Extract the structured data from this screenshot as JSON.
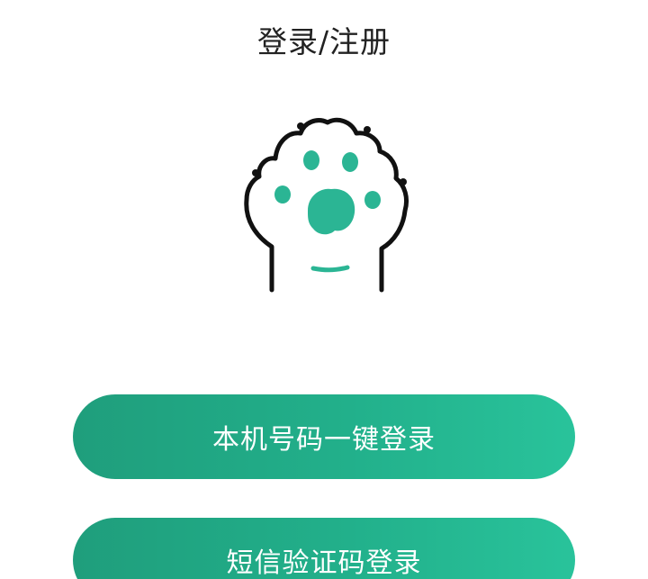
{
  "header": {
    "title": "登录/注册"
  },
  "mascot": {
    "icon": "cat-paw-icon",
    "colors": {
      "accent": "#2bb594",
      "outline": "#111111"
    }
  },
  "actions": {
    "one_click_login_label": "本机号码一键登录",
    "sms_login_label": "短信验证码登录"
  },
  "theme": {
    "button_gradient_start": "#1f9e7c",
    "button_gradient_end": "#29c39b",
    "button_text": "#ffffff"
  }
}
